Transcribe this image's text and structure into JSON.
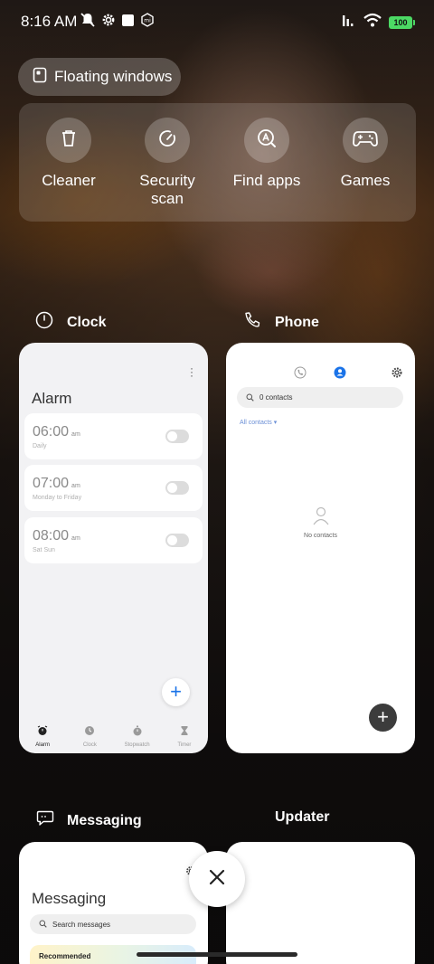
{
  "status_bar": {
    "time": "8:16 AM",
    "battery": "100",
    "icons": [
      "mute-icon",
      "gear-icon",
      "square-icon",
      "mi-icon",
      "signal-icon",
      "wifi-icon",
      "battery-icon"
    ]
  },
  "floating_windows": {
    "label": "Floating windows",
    "icon": "floating-window-icon"
  },
  "quick_tools": [
    {
      "label": "Cleaner",
      "icon": "trash-icon"
    },
    {
      "label": "Security scan",
      "label_line1": "Security",
      "label_line2": "scan",
      "icon": "security-gauge-icon"
    },
    {
      "label": "Find apps",
      "icon": "find-apps-icon"
    },
    {
      "label": "Games",
      "icon": "gamepad-icon"
    }
  ],
  "recent_apps": [
    {
      "name": "Clock",
      "icon": "clock-icon",
      "screen": {
        "title": "Alarm",
        "alarms": [
          {
            "time": "06:00",
            "ampm": "am",
            "days": "Daily",
            "enabled": false
          },
          {
            "time": "07:00",
            "ampm": "am",
            "days": "Monday to Friday",
            "enabled": false
          },
          {
            "time": "08:00",
            "ampm": "am",
            "days": "Sat Sun",
            "enabled": false
          }
        ],
        "nav": [
          "Alarm",
          "Clock",
          "Stopwatch",
          "Timer"
        ],
        "active_nav": "Alarm"
      }
    },
    {
      "name": "Phone",
      "icon": "phone-icon",
      "screen": {
        "search_placeholder": "0 contacts",
        "filter": "All contacts",
        "empty_text": "No contacts"
      }
    },
    {
      "name": "Messaging",
      "icon": "message-icon",
      "screen": {
        "title": "Messaging",
        "search_placeholder": "Search messages",
        "recommended": "Recommended"
      }
    },
    {
      "name": "Updater",
      "icon": "",
      "screen": {}
    }
  ],
  "colors": {
    "accent_blue": "#1a73e8",
    "battery_green": "#4cd964",
    "fab_dark": "#3c3c3c"
  }
}
